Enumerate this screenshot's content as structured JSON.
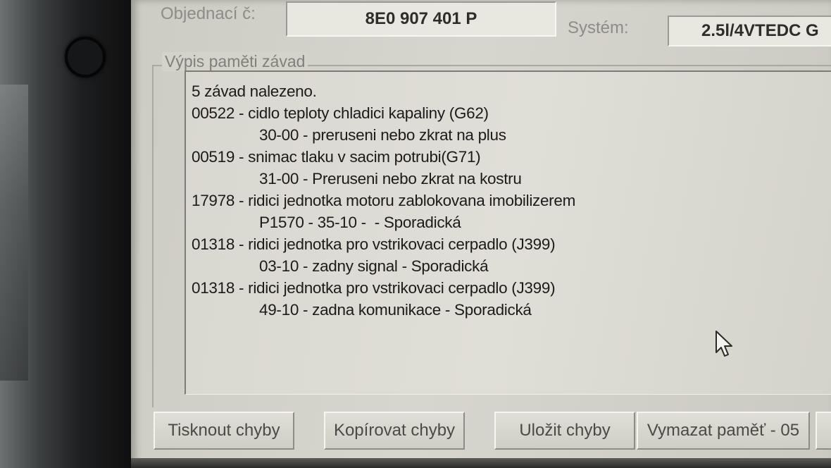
{
  "header": {
    "order_label": "Objednací č:",
    "order_value": "8E0 907 401 P",
    "system_label": "Systém:",
    "system_value": "2.5l/4VTEDC G"
  },
  "fault_memory": {
    "title": "Výpis paměti závad",
    "lines": [
      {
        "text": "5 závad nalezeno.",
        "indent": false
      },
      {
        "text": "00522 - cidlo teploty chladici kapaliny (G62)",
        "indent": false
      },
      {
        "text": "30-00 - preruseni nebo zkrat na plus",
        "indent": true
      },
      {
        "text": "00519 - snimac tlaku v sacim potrubi(G71)",
        "indent": false
      },
      {
        "text": "31-00 - Preruseni nebo zkrat na kostru",
        "indent": true
      },
      {
        "text": "17978 - ridici jednotka motoru zablokovana imobilizerem",
        "indent": false
      },
      {
        "text": "P1570 - 35-10 -  - Sporadická",
        "indent": true
      },
      {
        "text": "01318 - ridici jednotka pro vstrikovaci cerpadlo (J399)",
        "indent": false
      },
      {
        "text": "03-10 - zadny signal - Sporadická",
        "indent": true
      },
      {
        "text": "01318 - ridici jednotka pro vstrikovaci cerpadlo (J399)",
        "indent": false
      },
      {
        "text": "49-10 - zadna komunikace - Sporadická",
        "indent": true
      }
    ]
  },
  "buttons": {
    "print": "Tisknout chyby",
    "copy": "Kopírovat chyby",
    "save": "Uložit chyby",
    "erase": "Vymazat paměť - 05"
  },
  "icons": {
    "cursor": "mouse-pointer-icon"
  }
}
